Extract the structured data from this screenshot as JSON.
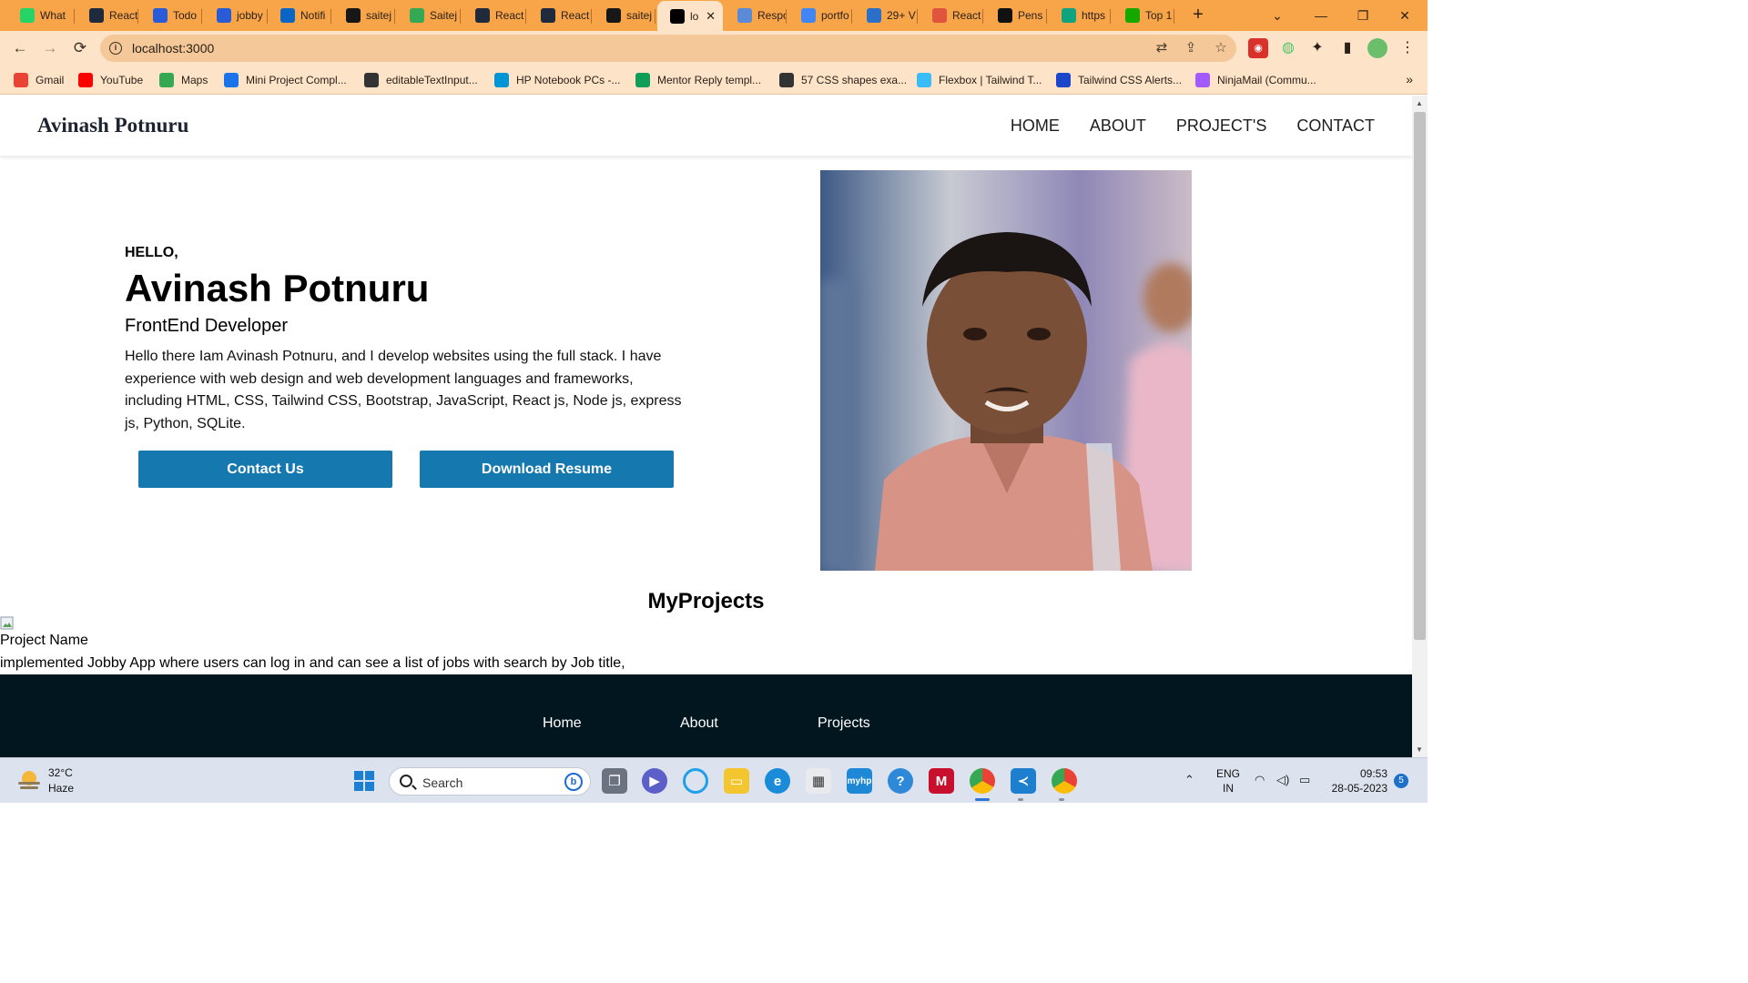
{
  "browser": {
    "tabs": [
      {
        "label": "What",
        "color": "#25d366",
        "icon": "whatsapp-icon"
      },
      {
        "label": "React",
        "color": "#1f2b3d",
        "icon": "react-icon"
      },
      {
        "label": "Todo",
        "color": "#2a5bd7",
        "icon": "bitbucket-icon"
      },
      {
        "label": "jobby",
        "color": "#2a5bd7",
        "icon": "bitbucket-icon"
      },
      {
        "label": "Notifi",
        "color": "#0a66c2",
        "icon": "linkedin-icon"
      },
      {
        "label": "saitej",
        "color": "#181717",
        "icon": "github-icon"
      },
      {
        "label": "Saitej",
        "color": "#34a853",
        "icon": "drive-icon"
      },
      {
        "label": "React",
        "color": "#1f2b3d",
        "icon": "react-icon"
      },
      {
        "label": "React",
        "color": "#1f2b3d",
        "icon": "react-icon"
      },
      {
        "label": "saitej",
        "color": "#181717",
        "icon": "github-icon"
      },
      {
        "label": "lo",
        "color": "#000000",
        "icon": "vercel-icon",
        "active": true
      },
      {
        "label": "Respo",
        "color": "#5b8bd6",
        "icon": "site-icon"
      },
      {
        "label": "portfo",
        "color": "#4285f4",
        "icon": "google-icon"
      },
      {
        "label": "29+ V",
        "color": "#2b6fc9",
        "icon": "site-icon"
      },
      {
        "label": "React",
        "color": "#e0533d",
        "icon": "react-icon"
      },
      {
        "label": "Pens",
        "color": "#111111",
        "icon": "codepen-icon"
      },
      {
        "label": "https",
        "color": "#10a37f",
        "icon": "openai-icon"
      },
      {
        "label": "Top 1",
        "color": "#14a800",
        "icon": "upwork-icon"
      }
    ],
    "url": "localhost:3000",
    "bookmarks": [
      {
        "label": "Gmail",
        "color": "#ea4335",
        "icon": "gmail-icon"
      },
      {
        "label": "YouTube",
        "color": "#ff0000",
        "icon": "youtube-icon"
      },
      {
        "label": "Maps",
        "color": "#34a853",
        "icon": "maps-icon"
      },
      {
        "label": "Mini Project Compl...",
        "color": "#1a73e8",
        "icon": "site-icon"
      },
      {
        "label": "editableTextInput...",
        "color": "#333333",
        "icon": "globe-icon"
      },
      {
        "label": "HP Notebook PCs -...",
        "color": "#0096d6",
        "icon": "hp-icon"
      },
      {
        "label": "Mentor Reply templ...",
        "color": "#0f9d58",
        "icon": "sheets-icon"
      },
      {
        "label": "57 CSS shapes exa...",
        "color": "#333333",
        "icon": "site-icon"
      },
      {
        "label": "Flexbox | Tailwind T...",
        "color": "#38bdf8",
        "icon": "tailwind-icon"
      },
      {
        "label": "Tailwind CSS Alerts...",
        "color": "#1a47c9",
        "icon": "site-icon"
      },
      {
        "label": "NinjaMail (Commu...",
        "color": "#a259ff",
        "icon": "figma-icon"
      }
    ]
  },
  "site": {
    "brand": "Avinash Potnuru",
    "nav": [
      "HOME",
      "ABOUT",
      "PROJECT'S",
      "CONTACT"
    ],
    "hero": {
      "greeting": "HELLO,",
      "name": "Avinash Potnuru",
      "role": "FrontEnd Developer",
      "description": "Hello there Iam Avinash Potnuru, and I develop websites using the full stack. I have experience with web design and web development languages and frameworks, including HTML, CSS, Tailwind CSS, Bootstrap, JavaScript, React js, Node js, express js, Python, SQLite.",
      "contact_button": "Contact Us",
      "resume_button": "Download Resume"
    },
    "projects": {
      "title": "MyProjects",
      "items": [
        {
          "name": "Project Name",
          "description": "implemented Jobby App where users can log in and can see a list of jobs with search by Job title,"
        }
      ]
    },
    "footer": {
      "links": [
        "Home",
        "About",
        "Projects"
      ]
    },
    "accent_color": "#1579b0",
    "footer_color": "#02161f"
  },
  "taskbar": {
    "weather": {
      "temp": "32°C",
      "desc": "Haze"
    },
    "search_placeholder": "Search",
    "lang": [
      "ENG",
      "IN"
    ],
    "time": "09:53",
    "date": "28-05-2023",
    "notifications": "5"
  }
}
